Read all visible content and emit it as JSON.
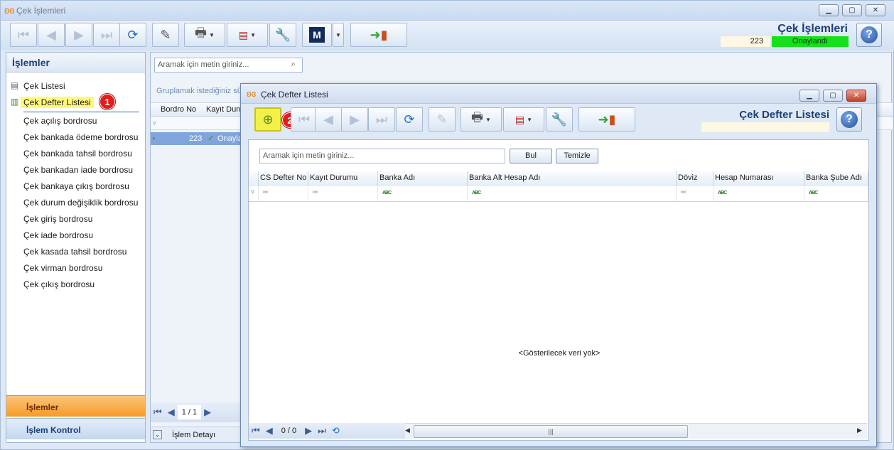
{
  "window": {
    "title": "Çek İşlemleri"
  },
  "header": {
    "title": "Çek İşlemleri",
    "record_number": "223",
    "status": "Onaylandı",
    "status_color": "#14e01c"
  },
  "sidebar": {
    "title": "İşlemler",
    "items": [
      {
        "label": "Çek Listesi"
      },
      {
        "label": "Çek Defter Listesi"
      },
      {
        "label": "Çek açılış bordrosu"
      },
      {
        "label": "Çek bankada ödeme bordrosu"
      },
      {
        "label": "Çek bankada tahsil bordrosu"
      },
      {
        "label": "Çek bankadan iade bordrosu"
      },
      {
        "label": "Çek bankaya çıkış bordrosu"
      },
      {
        "label": "Çek durum değişiklik bordrosu"
      },
      {
        "label": "Çek giriş bordrosu"
      },
      {
        "label": "Çek iade bordrosu"
      },
      {
        "label": "Çek kasada tahsil bordrosu"
      },
      {
        "label": "Çek virman bordrosu"
      },
      {
        "label": "Çek çıkış bordrosu"
      }
    ],
    "nav": [
      "İşlemler",
      "İşlem Kontrol"
    ]
  },
  "callouts": [
    "1",
    "2"
  ],
  "main": {
    "search_placeholder": "Aramak için metin giriniz...",
    "group_hint": "Gruplamak istediğiniz süt",
    "columns": [
      "Bordro No",
      "Kayıt Duru"
    ],
    "row": {
      "no": "223",
      "status": "Onayla"
    },
    "pager": "1 / 1",
    "detail_tab": "İşlem Detayı"
  },
  "dialog": {
    "title": "Çek Defter Listesi",
    "header_title": "Çek Defter Listesi",
    "search_placeholder": "Aramak için metin giriniz...",
    "find_label": "Bul",
    "clear_label": "Temizle",
    "columns": [
      "CS Defter No",
      "Kayıt Durumu",
      "Banka Adı",
      "Banka Alt Hesap Adı",
      "Döviz",
      "Hesap Numarası",
      "Banka Şube Adı"
    ],
    "empty_text": "<Gösterilecek veri yok>",
    "pager": "0 / 0"
  }
}
